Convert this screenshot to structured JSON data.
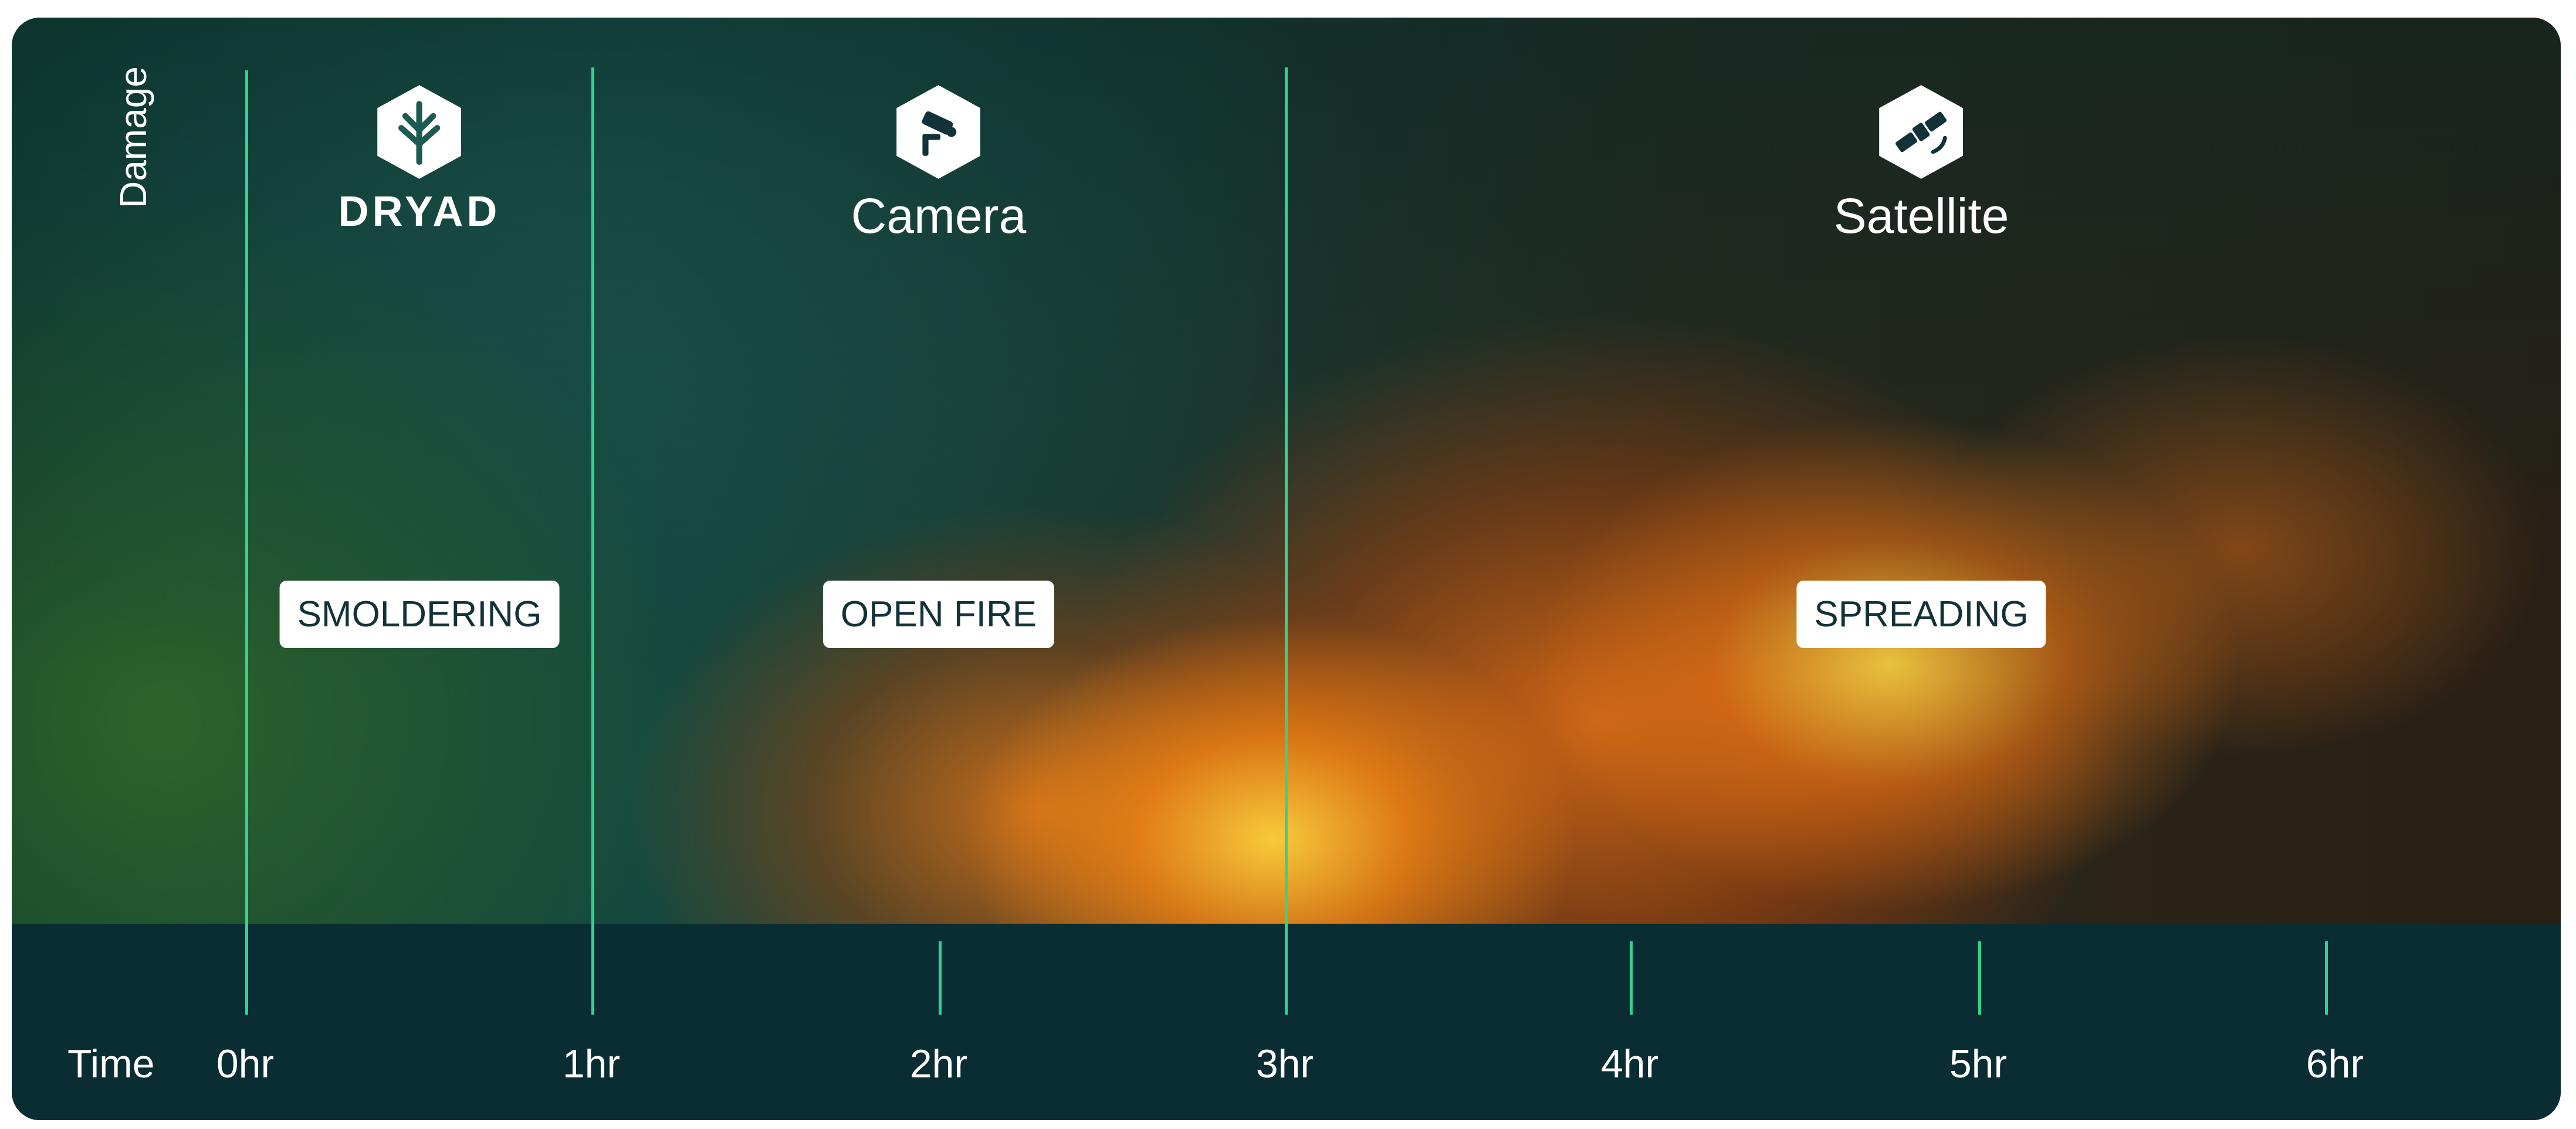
{
  "y_axis_label": "Damage",
  "x_axis_label": "Time",
  "ticks": [
    "0hr",
    "1hr",
    "2hr",
    "3hr",
    "4hr",
    "5hr",
    "6hr"
  ],
  "detectors": [
    {
      "label": "DRYAD",
      "icon": "tree-icon"
    },
    {
      "label": "Camera",
      "icon": "camera-icon"
    },
    {
      "label": "Satellite",
      "icon": "satellite-icon"
    }
  ],
  "stages": [
    "SMOLDERING",
    "OPEN FIRE",
    "SPREADING"
  ],
  "colors": {
    "accent": "#33d38f",
    "axis_bar": "#0a2d33",
    "stage_text": "#123238"
  }
}
